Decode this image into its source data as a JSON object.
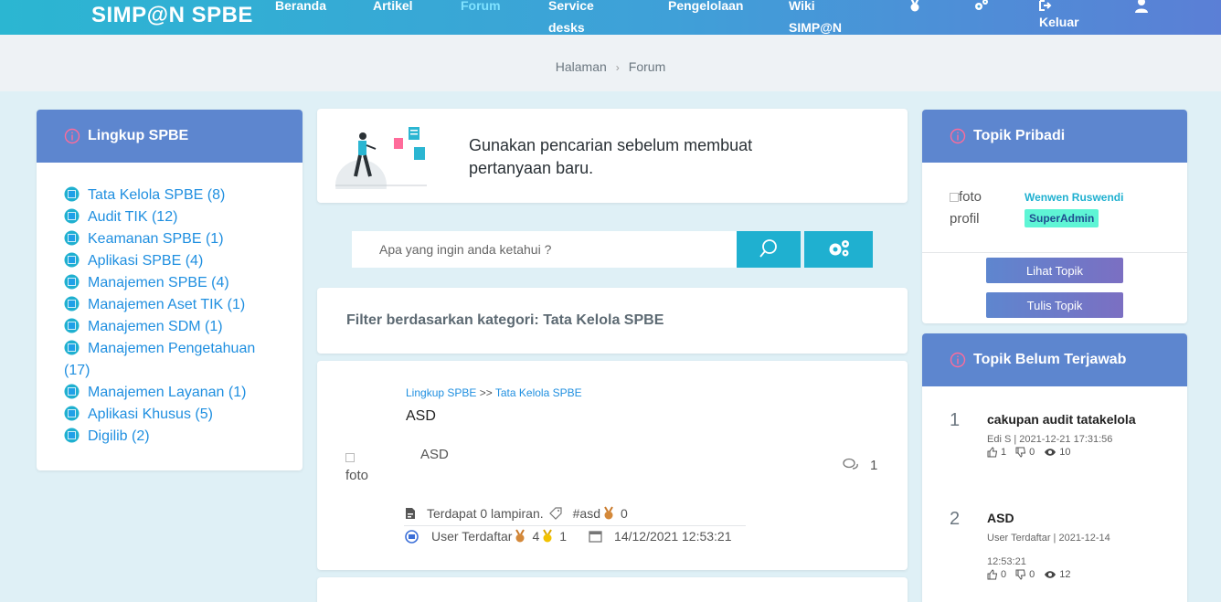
{
  "header": {
    "brand": "SIMP@N SPBE",
    "nav": {
      "beranda": "Beranda",
      "artikel": "Artikel",
      "forum": "Forum",
      "service_line1": "Service",
      "service_line2": "desks",
      "pengelolaan": "Pengelolaan",
      "wiki_line1": "Wiki",
      "wiki_line2": "SIMP@N",
      "keluar": "Keluar"
    },
    "icons": [
      "medal-icon",
      "gears-icon",
      "logout-icon",
      "user-icon"
    ]
  },
  "breadcrumb": {
    "home": "Halaman",
    "current": "Forum"
  },
  "sidebar": {
    "title": "Lingkup SPBE",
    "items": [
      "Tata Kelola SPBE (8)",
      "Audit TIK (12)",
      "Keamanan SPBE (1)",
      "Aplikasi SPBE (4)",
      "Manajemen SPBE (4)",
      "Manajemen Aset TIK (1)",
      "Manajemen SDM (1)",
      "Manajemen Pengetahuan (17)",
      "Manajemen Layanan (1)",
      "Aplikasi Khusus (5)",
      "Digilib (2)"
    ]
  },
  "hero": {
    "text": "Gunakan pencarian sebelum membuat pertanyaan baru."
  },
  "search": {
    "placeholder": "Apa yang ingin anda ketahui ?"
  },
  "filter": {
    "text": "Filter berdasarkan kategori: Tata Kelola SPBE"
  },
  "post": {
    "crumb_root": "Lingkup SPBE",
    "crumb_sep": ">>",
    "crumb_cat": "Tata Kelola SPBE",
    "title": "ASD",
    "avatar_alt": "foto",
    "body": "ASD",
    "comments": "1",
    "attachments": "Terdapat 0 lampiran.",
    "tag": "#asd",
    "tag_count": "0",
    "author": "User Terdaftar",
    "bronze": "4",
    "gold": "1",
    "date": "14/12/2021 12:53:21"
  },
  "profile": {
    "title": "Topik Pribadi",
    "avatar_alt": "foto profil",
    "name": "Wenwen Ruswendi",
    "role": "SuperAdmin",
    "view_btn": "Lihat Topik",
    "write_btn": "Tulis Topik"
  },
  "unanswered": {
    "title": "Topik Belum Terjawab",
    "items": [
      {
        "num": "1",
        "title": "cakupan audit tatakelola",
        "meta_line1": "Edi S | 2021-12-21 17:31:56",
        "meta_line2": "",
        "likes": "1",
        "dislikes": "0",
        "views": "10"
      },
      {
        "num": "2",
        "title": "ASD",
        "meta_line1": "User Terdaftar | 2021-12-14",
        "meta_line2": "12:53:21",
        "likes": "0",
        "dislikes": "0",
        "views": "12"
      }
    ]
  },
  "colors": {
    "header_start": "#2bb6d2",
    "header_end": "#5b7fd6",
    "card_head": "#5d86cf",
    "link": "#1f8fe0",
    "button": "#1fb0d0",
    "badge": "#5ef5d5"
  }
}
